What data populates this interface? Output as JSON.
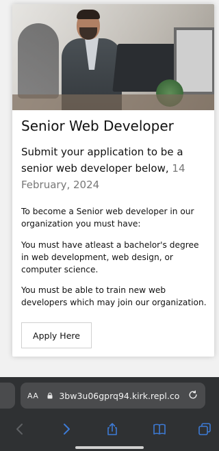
{
  "card": {
    "title": "Senior Web Developer",
    "subtitle_main": "Submit your application to be a senior web developer below,",
    "subtitle_date": "14 February, 2024",
    "paragraphs": [
      "To become a Senior web developer in our organization you must have:",
      "You must have atleast a bachelor's degree in web development, web design, or computer science.",
      "You must be able to train new web developers which may join our organization."
    ],
    "apply_label": "Apply Here"
  },
  "browser": {
    "text_size_label": "AA",
    "url": "3bw3u06gprq94.kirk.repl.co",
    "icons": {
      "lock": "lock-icon",
      "reload": "reload-icon",
      "back": "back-icon",
      "forward": "forward-icon",
      "share": "share-icon",
      "bookmarks": "bookmarks-icon",
      "tabs": "tabs-icon"
    }
  }
}
